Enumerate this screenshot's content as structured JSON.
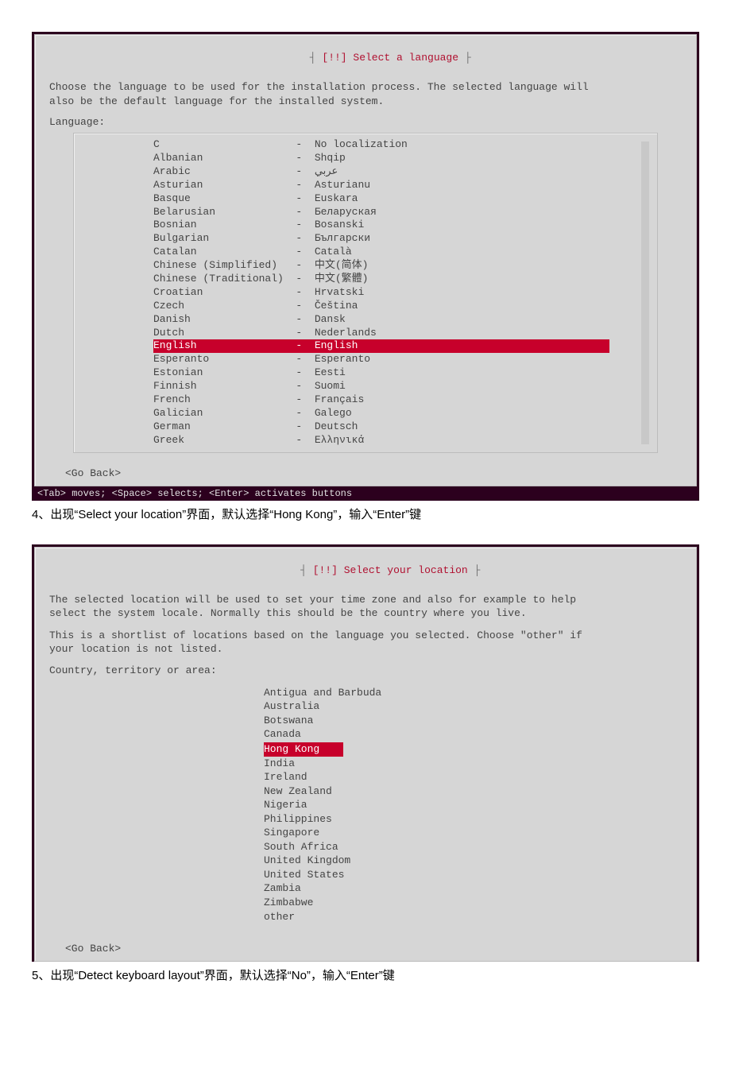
{
  "screen1": {
    "title_prefix": "┤ ",
    "title": "[!!] Select a language",
    "title_suffix": " ├",
    "instructions": "Choose the language to be used for the installation process. The selected language will\nalso be the default language for the installed system.",
    "label": "Language:",
    "go_back": "<Go Back>",
    "footer": "<Tab> moves; <Space> selects; <Enter> activates buttons",
    "list": [
      {
        "left": "C",
        "right": "No localization",
        "sel": false
      },
      {
        "left": "Albanian",
        "right": "Shqip",
        "sel": false
      },
      {
        "left": "Arabic",
        "right": "عربي",
        "sel": false
      },
      {
        "left": "Asturian",
        "right": "Asturianu",
        "sel": false
      },
      {
        "left": "Basque",
        "right": "Euskara",
        "sel": false
      },
      {
        "left": "Belarusian",
        "right": "Беларуская",
        "sel": false
      },
      {
        "left": "Bosnian",
        "right": "Bosanski",
        "sel": false
      },
      {
        "left": "Bulgarian",
        "right": "Български",
        "sel": false
      },
      {
        "left": "Catalan",
        "right": "Català",
        "sel": false
      },
      {
        "left": "Chinese (Simplified)",
        "right": "中文(简体)",
        "sel": false
      },
      {
        "left": "Chinese (Traditional)",
        "right": "中文(繁體)",
        "sel": false
      },
      {
        "left": "Croatian",
        "right": "Hrvatski",
        "sel": false
      },
      {
        "left": "Czech",
        "right": "Čeština",
        "sel": false
      },
      {
        "left": "Danish",
        "right": "Dansk",
        "sel": false
      },
      {
        "left": "Dutch",
        "right": "Nederlands",
        "sel": false
      },
      {
        "left": "English",
        "right": "English",
        "sel": true
      },
      {
        "left": "Esperanto",
        "right": "Esperanto",
        "sel": false
      },
      {
        "left": "Estonian",
        "right": "Eesti",
        "sel": false
      },
      {
        "left": "Finnish",
        "right": "Suomi",
        "sel": false
      },
      {
        "left": "French",
        "right": "Français",
        "sel": false
      },
      {
        "left": "Galician",
        "right": "Galego",
        "sel": false
      },
      {
        "left": "German",
        "right": "Deutsch",
        "sel": false
      },
      {
        "left": "Greek",
        "right": "Ελληνικά",
        "sel": false
      }
    ]
  },
  "caption1": "4、出现“Select your location”界面，默认选择“Hong Kong”，输入“Enter”键",
  "screen2": {
    "title_prefix": "┤ ",
    "title": "[!!] Select your location",
    "title_suffix": " ├",
    "instr1": "The selected location will be used to set your time zone and also for example to help\nselect the system locale. Normally this should be the country where you live.",
    "instr2": "This is a shortlist of locations based on the language you selected. Choose \"other\" if\nyour location is not listed.",
    "label": "Country, territory or area:",
    "go_back": "<Go Back>",
    "list": [
      {
        "name": "Antigua and Barbuda",
        "sel": false
      },
      {
        "name": "Australia",
        "sel": false
      },
      {
        "name": "Botswana",
        "sel": false
      },
      {
        "name": "Canada",
        "sel": false
      },
      {
        "name": "Hong Kong",
        "sel": true
      },
      {
        "name": "India",
        "sel": false
      },
      {
        "name": "Ireland",
        "sel": false
      },
      {
        "name": "New Zealand",
        "sel": false
      },
      {
        "name": "Nigeria",
        "sel": false
      },
      {
        "name": "Philippines",
        "sel": false
      },
      {
        "name": "Singapore",
        "sel": false
      },
      {
        "name": "South Africa",
        "sel": false
      },
      {
        "name": "United Kingdom",
        "sel": false
      },
      {
        "name": "United States",
        "sel": false
      },
      {
        "name": "Zambia",
        "sel": false
      },
      {
        "name": "Zimbabwe",
        "sel": false
      },
      {
        "name": "other",
        "sel": false
      }
    ]
  },
  "caption2": "5、出现“Detect keyboard layout”界面，默认选择“No”，输入“Enter”键"
}
